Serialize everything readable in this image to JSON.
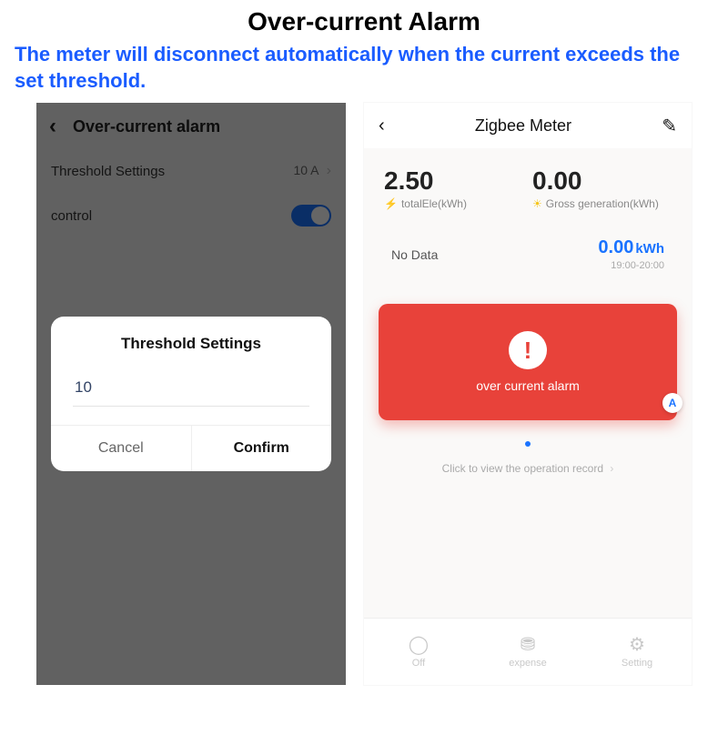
{
  "heading": "Over-current Alarm",
  "subheading": "The meter will disconnect automatically when the current exceeds the set threshold.",
  "left": {
    "header_title": "Over-current alarm",
    "row_threshold_label": "Threshold Settings",
    "row_threshold_value": "10 A",
    "row_control_label": "control",
    "control_on": true,
    "dialog": {
      "title": "Threshold Settings",
      "input_value": "10",
      "cancel": "Cancel",
      "confirm": "Confirm"
    }
  },
  "right": {
    "header_title": "Zigbee Meter",
    "stats": {
      "total_ele_value": "2.50",
      "total_ele_label": "totalEle(kWh)",
      "gross_gen_value": "0.00",
      "gross_gen_label": "Gross generation(kWh)"
    },
    "mid": {
      "no_data": "No Data",
      "kwh_value": "0.00",
      "kwh_unit": "kWh",
      "time_range": "19:00-20:00"
    },
    "alarm": {
      "message": "over current alarm",
      "badge": "A"
    },
    "record_text": "Click to view the operation record",
    "bottom": {
      "off": "Off",
      "expense": "expense",
      "setting": "Setting"
    }
  }
}
